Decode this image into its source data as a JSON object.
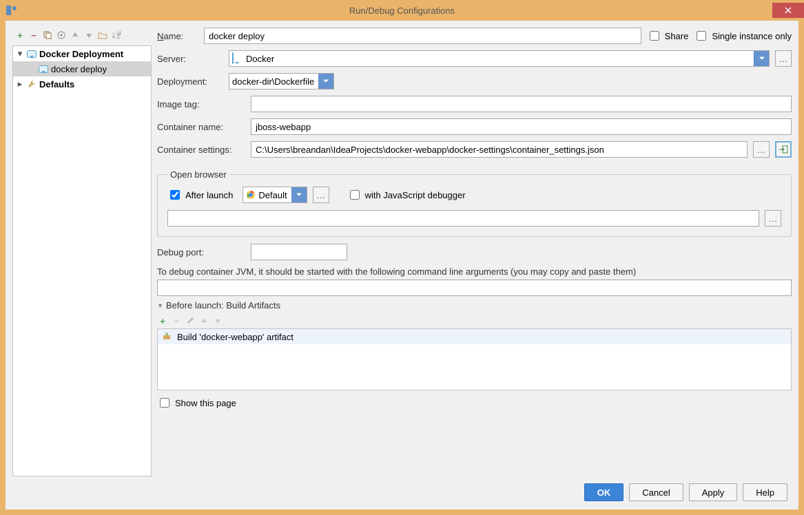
{
  "window": {
    "title": "Run/Debug Configurations"
  },
  "tree": {
    "category": "Docker Deployment",
    "child": "docker deploy",
    "defaults": "Defaults"
  },
  "form": {
    "name_label": "Name:",
    "name_value": "docker deploy",
    "share_label": "Share",
    "single_label": "Single instance only",
    "server_label": "Server:",
    "server_value": "Docker",
    "deployment_label": "Deployment:",
    "deployment_value": "docker-dir\\Dockerfile",
    "image_tag_label": "Image tag:",
    "image_tag_value": "",
    "container_name_label": "Container name:",
    "container_name_value": "jboss-webapp",
    "container_settings_label": "Container settings:",
    "container_settings_value": "C:\\Users\\breandan\\IdeaProjects\\docker-webapp\\docker-settings\\container_settings.json",
    "open_browser_legend": "Open browser",
    "after_launch_label": "After launch",
    "browser_value": "Default",
    "js_debug_label": "with JavaScript debugger",
    "url_value": "",
    "debug_port_label": "Debug port:",
    "debug_port_value": "",
    "debug_hint": "To debug container JVM, it should be started with the following command line arguments (you may copy and paste them)",
    "cmdline_value": "",
    "before_launch_label": "Before launch: Build Artifacts",
    "task": "Build 'docker-webapp' artifact",
    "show_page_label": "Show this page"
  },
  "buttons": {
    "ok": "OK",
    "cancel": "Cancel",
    "apply": "Apply",
    "help": "Help"
  }
}
